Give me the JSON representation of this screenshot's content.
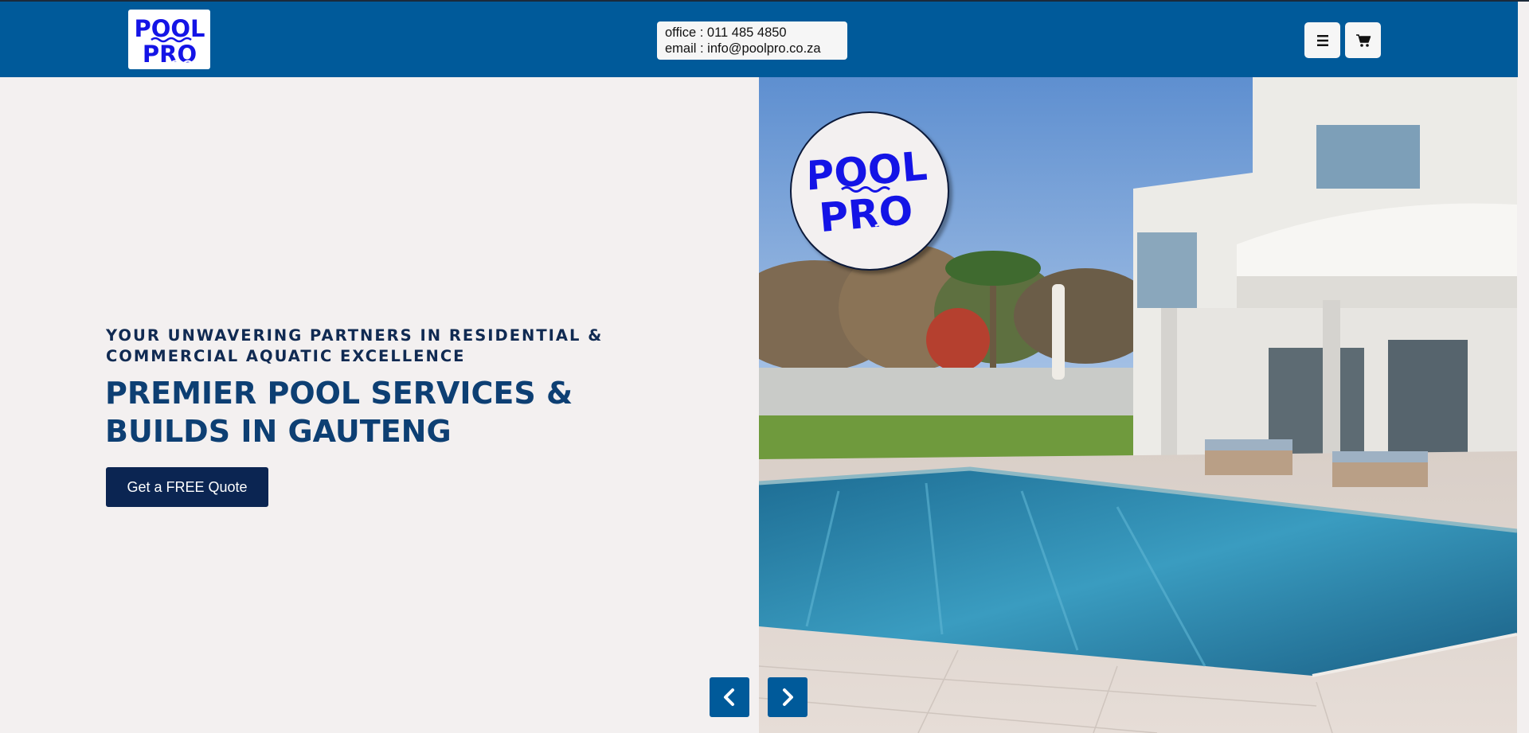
{
  "header": {
    "logo": {
      "line1": "POOL",
      "line2": "PRO"
    },
    "contact": {
      "office": "office : 011 485 4850",
      "email": "email : info@poolpro.co.za"
    },
    "menu_icon": "hamburger-icon",
    "cart_icon": "cart-icon"
  },
  "hero": {
    "eyebrow": "YOUR UNWAVERING PARTNERS IN RESIDENTIAL & COMMERCIAL AQUATIC EXCELLENCE",
    "headline": "PREMIER POOL SERVICES & BUILDS IN GAUTENG",
    "cta_label": "Get a FREE Quote",
    "image_logo": {
      "line1": "POOL",
      "line2": "PRO"
    },
    "prev_icon": "chevron-left-icon",
    "next_icon": "chevron-right-icon"
  },
  "colors": {
    "header_bg": "#005a9a",
    "headline": "#0d3f73",
    "eyebrow": "#102a52",
    "cta_bg": "#0b2552",
    "logo_blue": "#1414e6",
    "page_bg": "#f3f0f0"
  }
}
